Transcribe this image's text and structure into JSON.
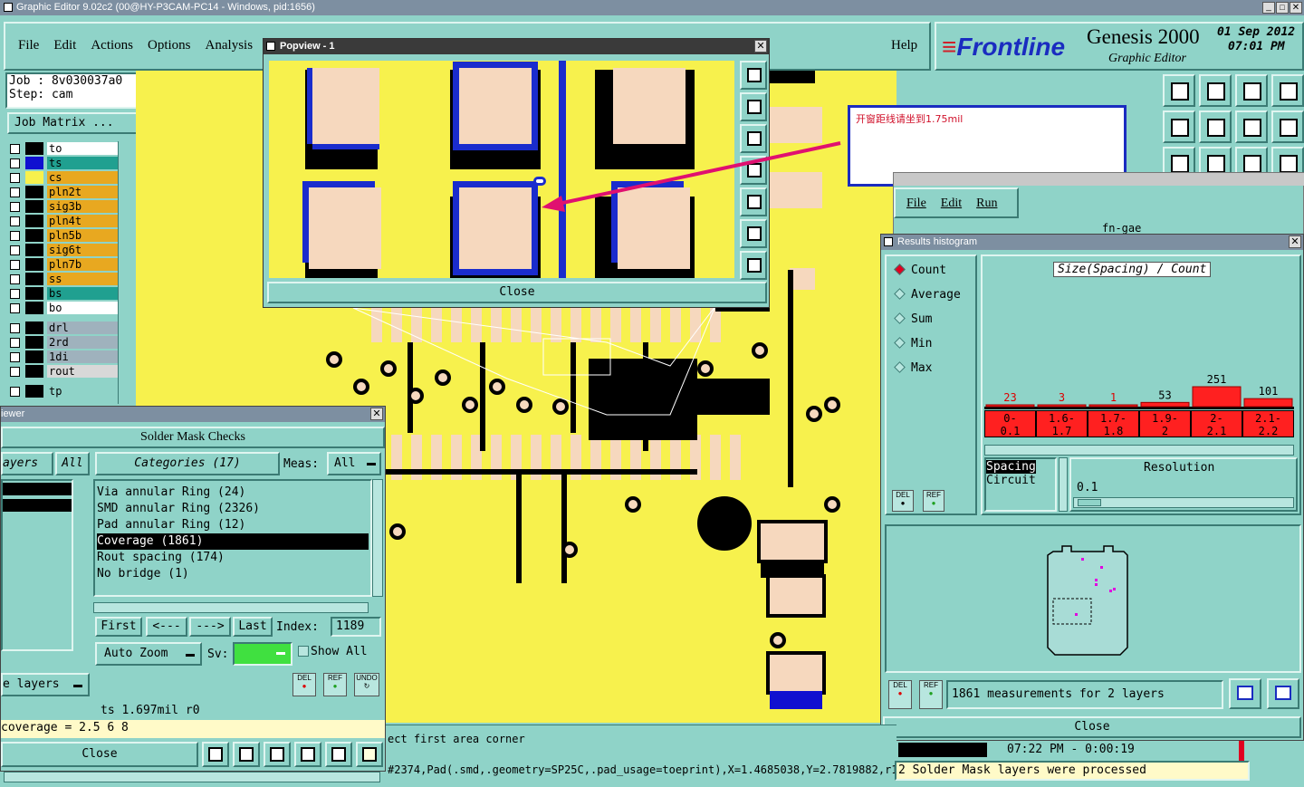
{
  "window": {
    "title": "Graphic Editor 9.02c2 (00@HY-P3CAM-PC14 - Windows, pid:1656)"
  },
  "menu": [
    "File",
    "Edit",
    "Actions",
    "Options",
    "Analysis"
  ],
  "help_label": "Help",
  "brand": {
    "logo": "Frontline",
    "product": "Genesis 2000",
    "subtitle": "Graphic Editor",
    "date": "01 Sep 2012",
    "time": "07:01 PM"
  },
  "job": {
    "job_line": "Job : 8v030037a0",
    "step_line": "Step: cam",
    "matrix_button": "Job Matrix ..."
  },
  "layers": [
    {
      "name": "to",
      "color": "#ffffff",
      "sw": "#000000"
    },
    {
      "name": "ts",
      "color": "#20a090",
      "sw": "#1010d0"
    },
    {
      "name": "cs",
      "color": "#e8a820",
      "sw": "#f7f14d"
    },
    {
      "name": "pln2t",
      "color": "#e8a820",
      "sw": "#000000"
    },
    {
      "name": "sig3b",
      "color": "#e8a820",
      "sw": "#000000"
    },
    {
      "name": "pln4t",
      "color": "#e8a820",
      "sw": "#000000"
    },
    {
      "name": "pln5b",
      "color": "#e8a820",
      "sw": "#000000"
    },
    {
      "name": "sig6t",
      "color": "#e8a820",
      "sw": "#000000"
    },
    {
      "name": "pln7b",
      "color": "#e8a820",
      "sw": "#000000"
    },
    {
      "name": "ss",
      "color": "#e8a820",
      "sw": "#000000"
    },
    {
      "name": "bs",
      "color": "#20a090",
      "sw": "#000000"
    },
    {
      "name": "bo",
      "color": "#ffffff",
      "sw": "#000000"
    }
  ],
  "drill_layers": [
    {
      "name": "drl",
      "color": "#9fb2bd"
    },
    {
      "name": "2rd",
      "color": "#9fb2bd"
    },
    {
      "name": "1di",
      "color": "#9fb2bd"
    },
    {
      "name": "rout",
      "color": "#d8d8d8"
    }
  ],
  "extra_layers": [
    {
      "name": "tp",
      "color": "#8fd3c8"
    }
  ],
  "popview": {
    "title": "Popview - 1",
    "close": "Close"
  },
  "annotation": {
    "text": "开窗距线请坐到1.75mil"
  },
  "run_menu": [
    "File",
    "Edit",
    "Run"
  ],
  "run_header": "fn-gae",
  "histogram": {
    "title": "Results histogram",
    "options": [
      "Count",
      "Average",
      "Sum",
      "Min",
      "Max"
    ],
    "selected": "Count",
    "header": "Size(Spacing) / Count",
    "bins": [
      "0-\n0.1",
      "1.6-\n1.7",
      "1.7-\n1.8",
      "1.9-\n2",
      "2-\n2.1",
      "2.1-\n2.2"
    ],
    "counts": [
      "23",
      "3",
      "1",
      "53",
      "251",
      "101"
    ],
    "resolution_label": "Resolution",
    "resolution_value": "0.1",
    "list_items": [
      "Spacing",
      "Circuit"
    ],
    "summary": "1861 measurements for 2 layers",
    "close": "Close",
    "del": "DEL",
    "ref": "REF"
  },
  "chart_data": {
    "type": "bar",
    "title": "Size(Spacing) / Count",
    "categories": [
      "0-0.1",
      "1.6-1.7",
      "1.7-1.8",
      "1.9-2",
      "2-2.1",
      "2.1-2.2"
    ],
    "values": [
      23,
      3,
      1,
      53,
      251,
      101
    ]
  },
  "viewer": {
    "title": "iewer",
    "heading": "Solder Mask Checks",
    "layers_label": "ayers",
    "all_label": "All",
    "categories_label": "Categories (17)",
    "meas_label": "Meas:",
    "meas_value": "All",
    "categories": [
      "Via annular Ring (24)",
      "SMD annular Ring (2326)",
      "Pad annular Ring (12)",
      "Coverage (1861)",
      "Rout spacing (174)",
      "No bridge (1)"
    ],
    "selected_category": "Coverage (1861)",
    "first": "First",
    "prev": "<---",
    "next": "--->",
    "last": "Last",
    "index_label": "Index:",
    "index_value": "1189",
    "autozoom": "Auto Zoom",
    "sv_label": "Sv:",
    "show_all": "Show All",
    "e_layers": "e layers",
    "del": "DEL",
    "ref": "REF",
    "undo": "UNDO",
    "status1": "ts 1.697mil  r0",
    "status2": "coverage = 2.5 6 8",
    "close": "Close"
  },
  "status": {
    "prompt": "ect first area corner",
    "info": "#2374,Pad(.smd,.geometry=SP25C,.pad_usage=toeprint),X=1.4685038,Y=2.7819882,r12",
    "clock": "07:22 PM - 0:00:19",
    "msg": "2 Solder Mask layers were processed"
  },
  "colors": {
    "teal": "#8fd3c8",
    "board": "#f7f14d",
    "pad": "#f6d8be",
    "bar": "#ff2020",
    "annotation": "#e01070"
  }
}
